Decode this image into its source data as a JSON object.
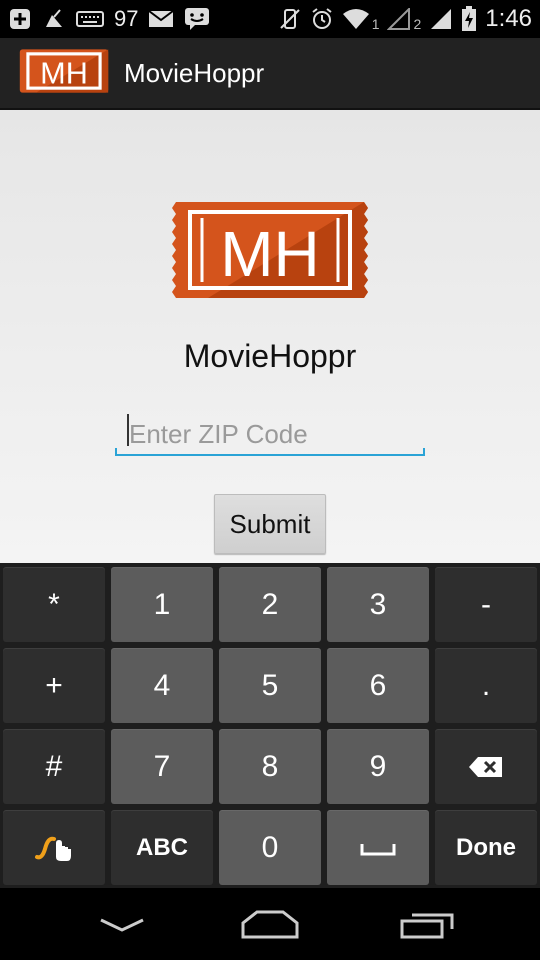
{
  "status_bar": {
    "battery_percent_label": "97",
    "sim1_label": "1",
    "sim2_label": "2",
    "time": "1:46"
  },
  "action_bar": {
    "title": "MovieHoppr",
    "logo_text": "MH"
  },
  "main": {
    "logo_text": "MH",
    "app_name": "MovieHoppr",
    "zip_placeholder": "Enter ZIP Code",
    "zip_value": "",
    "submit_label": "Submit"
  },
  "keyboard": {
    "rows": [
      [
        "*",
        "1",
        "2",
        "3",
        "-"
      ],
      [
        "+",
        "4",
        "5",
        "6",
        "."
      ],
      [
        "#",
        "7",
        "8",
        "9",
        "backspace-icon"
      ],
      [
        "swype-icon",
        "ABC",
        "0",
        "space-icon",
        "Done"
      ]
    ],
    "key_labels": {
      "star": "*",
      "one": "1",
      "two": "2",
      "three": "3",
      "minus": "-",
      "plus": "+",
      "four": "4",
      "five": "5",
      "six": "6",
      "dot": ".",
      "hash": "#",
      "seven": "7",
      "eight": "8",
      "nine": "9",
      "abc": "ABC",
      "zero": "0",
      "done": "Done"
    }
  },
  "colors": {
    "brand_orange": "#d4541c",
    "accent_blue": "#2aa3d6",
    "action_bar_bg": "#222222",
    "key_bg": "#5c5c5c",
    "key_dark_bg": "#2e2e2e"
  },
  "icons": [
    "back-icon",
    "home-icon",
    "recent-apps-icon",
    "backspace-icon",
    "swype-icon",
    "space-icon"
  ]
}
